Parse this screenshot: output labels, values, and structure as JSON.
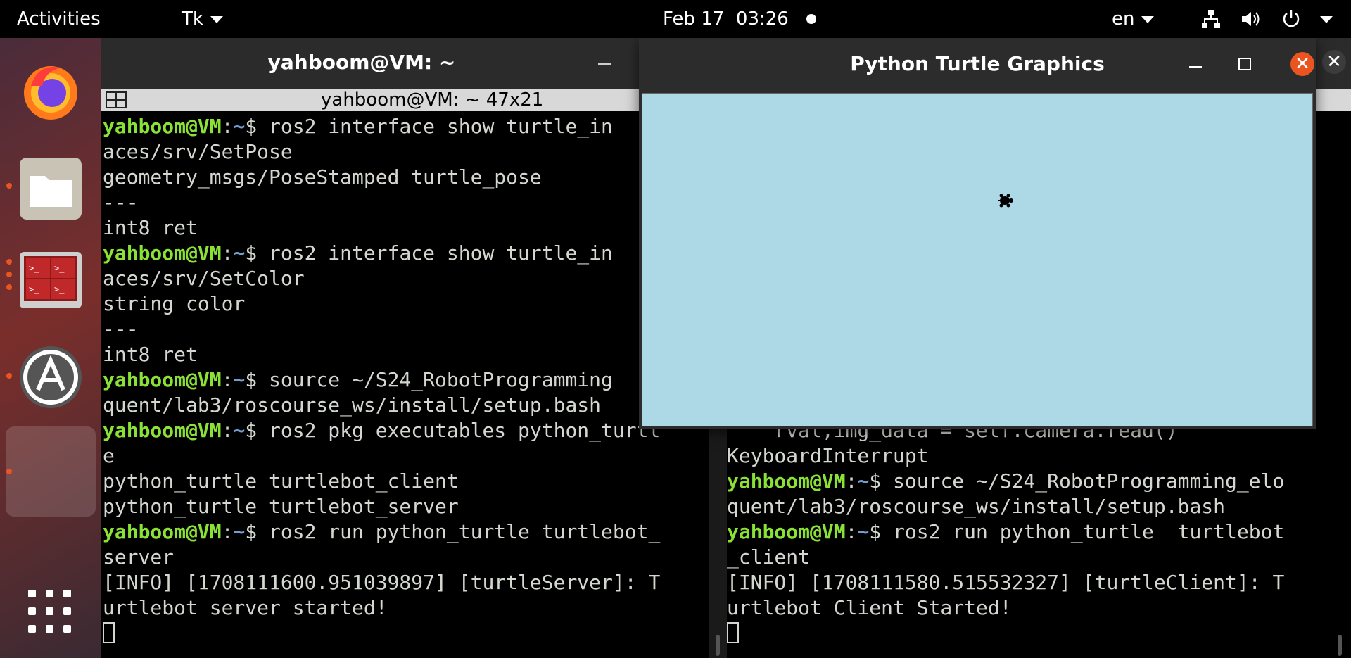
{
  "topbar": {
    "activities": "Activities",
    "app_menu": "Tk",
    "date": "Feb 17",
    "time": "03:26",
    "language": "en"
  },
  "dock": {
    "items": [
      "firefox-icon",
      "files-icon",
      "terminator-icon",
      "software-updater-icon",
      "running-app-slot",
      "show-applications-icon"
    ]
  },
  "terminal": {
    "window_title": "yahboom@VM: ~",
    "subtitle": "yahboom@VM: ~ 47x21",
    "left_pane": [
      {
        "user": "yahboom@VM",
        "path": "~",
        "cmd": "$ ros2 interface show turtle_in"
      },
      {
        "text": "aces/srv/SetPose"
      },
      {
        "text": "geometry_msgs/PoseStamped turtle_pose"
      },
      {
        "text": "---"
      },
      {
        "text": "int8 ret"
      },
      {
        "user": "yahboom@VM",
        "path": "~",
        "cmd": "$ ros2 interface show turtle_in"
      },
      {
        "text": "aces/srv/SetColor"
      },
      {
        "text": "string color"
      },
      {
        "text": "---"
      },
      {
        "text": "int8 ret"
      },
      {
        "user": "yahboom@VM",
        "path": "~",
        "cmd": "$ source ~/S24_RobotProgramming"
      },
      {
        "text": "quent/lab3/roscourse_ws/install/setup.bash"
      },
      {
        "user": "yahboom@VM",
        "path": "~",
        "cmd": "$ ros2 pkg executables python_turtl"
      },
      {
        "text": "e"
      },
      {
        "text": "python_turtle turtlebot_client"
      },
      {
        "text": "python_turtle turtlebot_server"
      },
      {
        "user": "yahboom@VM",
        "path": "~",
        "cmd": "$ ros2 run python_turtle turtlebot_"
      },
      {
        "text": "server"
      },
      {
        "text": "[INFO] [1708111600.951039897] [turtleServer]: T"
      },
      {
        "text": "urtlebot server started!"
      }
    ],
    "right_pane": [
      {
        "text": "    rval,img_data = self.camera.read()"
      },
      {
        "text": "KeyboardInterrupt"
      },
      {
        "user": "yahboom@VM",
        "path": "~",
        "cmd": "$ source ~/S24_RobotProgramming_elo"
      },
      {
        "text": "quent/lab3/roscourse_ws/install/setup.bash"
      },
      {
        "user": "yahboom@VM",
        "path": "~",
        "cmd": "$ ros2 run python_turtle  turtlebot"
      },
      {
        "text": "_client"
      },
      {
        "text": "[INFO] [1708111580.515532327] [turtleClient]: T"
      },
      {
        "text": "urtlebot Client Started!"
      }
    ]
  },
  "turtle_window": {
    "title": "Python Turtle Graphics",
    "canvas_color": "#add8e6"
  },
  "colors": {
    "prompt_user": "#8ae234",
    "prompt_path": "#729fcf",
    "accent": "#e95420"
  }
}
